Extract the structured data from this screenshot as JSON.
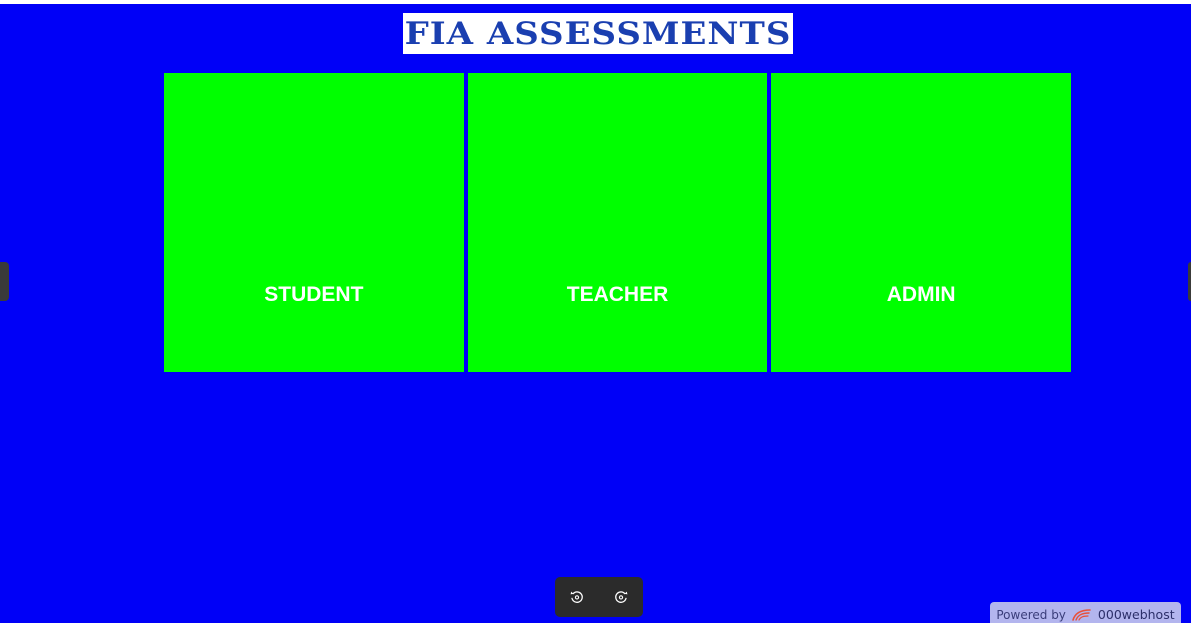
{
  "header": {
    "title": "FIA  ASSESSMENTS"
  },
  "cards": [
    {
      "label": "STUDENT"
    },
    {
      "label": "TEACHER"
    },
    {
      "label": "ADMIN"
    }
  ],
  "toolbar": {
    "rotate_left_icon": "rotate-left-icon",
    "rotate_right_icon": "rotate-right-icon"
  },
  "footer": {
    "powered_by": "Powered by",
    "brand": "000webhost"
  },
  "colors": {
    "background": "#0000f7",
    "card": "#00ff00",
    "title_text": "#1a3fb0",
    "toolbar": "#2b2b2b",
    "badge": "#b3b5ee"
  }
}
